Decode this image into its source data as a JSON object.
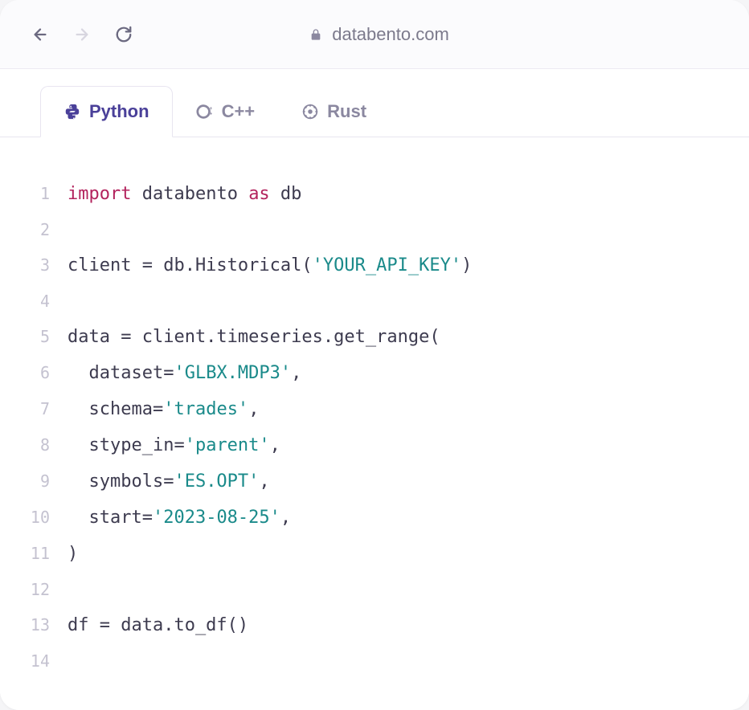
{
  "url": "databento.com",
  "tabs": [
    {
      "label": "Python",
      "icon": "python-icon",
      "active": true
    },
    {
      "label": "C++",
      "icon": "cpp-icon",
      "active": false
    },
    {
      "label": "Rust",
      "icon": "rust-icon",
      "active": false
    }
  ],
  "code": {
    "lines": [
      {
        "n": "1",
        "tokens": [
          {
            "t": "import",
            "c": "kw"
          },
          {
            "t": " databento ",
            "c": ""
          },
          {
            "t": "as",
            "c": "kw"
          },
          {
            "t": " db",
            "c": ""
          }
        ]
      },
      {
        "n": "2",
        "tokens": []
      },
      {
        "n": "3",
        "tokens": [
          {
            "t": "client = db.Historical(",
            "c": ""
          },
          {
            "t": "'YOUR_API_KEY'",
            "c": "str"
          },
          {
            "t": ")",
            "c": ""
          }
        ]
      },
      {
        "n": "4",
        "tokens": []
      },
      {
        "n": "5",
        "tokens": [
          {
            "t": "data = client.timeseries.get_range(",
            "c": ""
          }
        ]
      },
      {
        "n": "6",
        "tokens": [
          {
            "t": "  dataset=",
            "c": ""
          },
          {
            "t": "'GLBX.MDP3'",
            "c": "str"
          },
          {
            "t": ",",
            "c": ""
          }
        ]
      },
      {
        "n": "7",
        "tokens": [
          {
            "t": "  schema=",
            "c": ""
          },
          {
            "t": "'trades'",
            "c": "str"
          },
          {
            "t": ",",
            "c": ""
          }
        ]
      },
      {
        "n": "8",
        "tokens": [
          {
            "t": "  stype_in=",
            "c": ""
          },
          {
            "t": "'parent'",
            "c": "str"
          },
          {
            "t": ",",
            "c": ""
          }
        ]
      },
      {
        "n": "9",
        "tokens": [
          {
            "t": "  symbols=",
            "c": ""
          },
          {
            "t": "'ES.OPT'",
            "c": "str"
          },
          {
            "t": ",",
            "c": ""
          }
        ]
      },
      {
        "n": "10",
        "tokens": [
          {
            "t": "  start=",
            "c": ""
          },
          {
            "t": "'2023-08-25'",
            "c": "str"
          },
          {
            "t": ",",
            "c": ""
          }
        ]
      },
      {
        "n": "11",
        "tokens": [
          {
            "t": ")",
            "c": ""
          }
        ]
      },
      {
        "n": "12",
        "tokens": []
      },
      {
        "n": "13",
        "tokens": [
          {
            "t": "df = data.to_df()",
            "c": ""
          }
        ]
      },
      {
        "n": "14",
        "tokens": []
      }
    ]
  }
}
